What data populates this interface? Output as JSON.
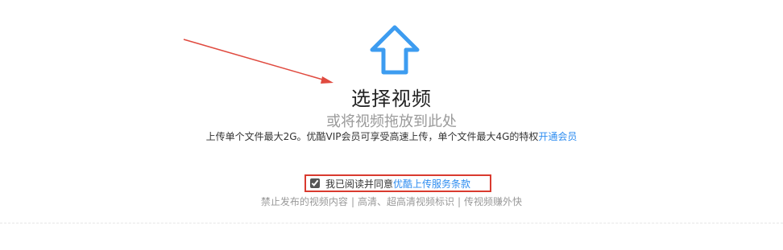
{
  "upload": {
    "icon": "upload-arrow-icon",
    "title": "选择视频",
    "drop_hint": "或将视频拖放到此处",
    "limit_text": "上传单个文件最大2G。优酷VIP会员可享受高速上传，单个文件最大4G的特权",
    "vip_link": "开通会员"
  },
  "agreement": {
    "checked": true,
    "text": "我已阅读并同意",
    "link": "优酷上传服务条款"
  },
  "rules": {
    "links": [
      "禁止发布的视频内容",
      "高清、超高清视频标识",
      "传视频赚外快"
    ],
    "separator": "|"
  },
  "colors": {
    "icon_blue": "#3d9cf0",
    "link_blue": "#2d8cf0",
    "annotation_red": "#d93a2f"
  }
}
